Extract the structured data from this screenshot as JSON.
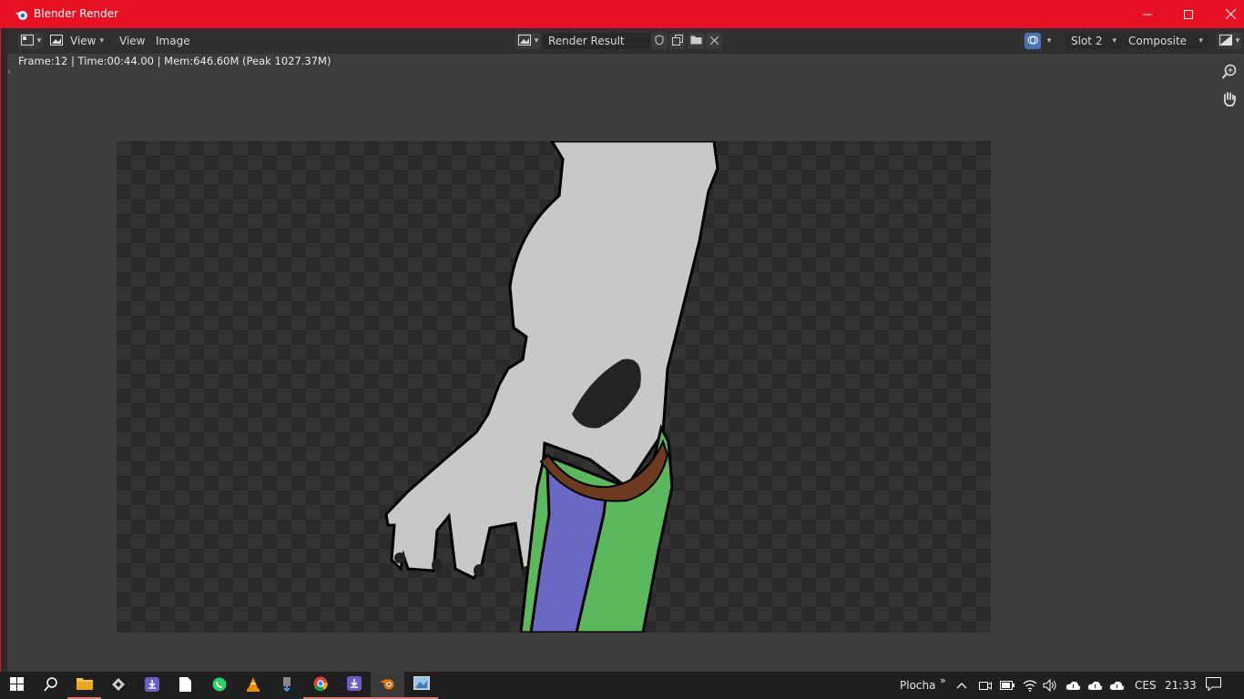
{
  "window": {
    "title": "Blender Render",
    "minimize": "–",
    "maximize": "☐",
    "close": "✕"
  },
  "header": {
    "view_label": "View",
    "menus": [
      "View",
      "Image"
    ],
    "image_name": "Render Result",
    "slot": "Slot 2",
    "layer": "Composite"
  },
  "info": {
    "text": "Frame:12 | Time:00:44.00 | Mem:646.60M (Peak 1027.37M)"
  },
  "tools": [
    "zoom-icon",
    "hand-pan-icon"
  ],
  "taskbar": {
    "apps": [
      "start-icon",
      "search-icon",
      "file-explorer-icon",
      "app-icon",
      "downloader-icon",
      "notepad-icon",
      "whatsapp-icon",
      "vlc-icon",
      "usb-icon",
      "chrome-icon",
      "downloader-icon",
      "blender-icon",
      "photos-icon"
    ],
    "desktop_label": "Plocha",
    "language": "CES",
    "time": "21:33"
  },
  "colors": {
    "titlebar": "#e81123",
    "header": "#303030",
    "viewport": "#3d3d3d",
    "skin": "#c8c8c8",
    "pants_green": "#5cb85c",
    "pants_blue": "#6a68c4",
    "belt": "#6b3a1f"
  }
}
